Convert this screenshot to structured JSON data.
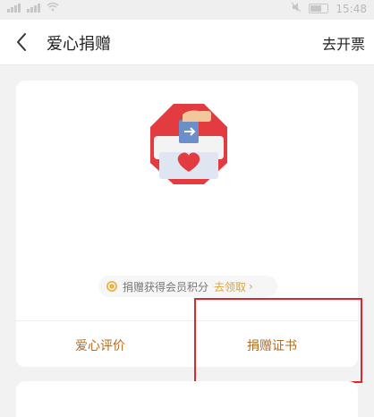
{
  "status_bar": {
    "time": "15:48"
  },
  "header": {
    "title": "爱心捐赠",
    "right_action": "去开票"
  },
  "points": {
    "text": "捐赠获得会员积分",
    "link": "去领取",
    "chevron": "›"
  },
  "actions": {
    "review": "爱心评价",
    "certificate": "捐赠证书"
  },
  "colors": {
    "accent_gold": "#d9a441",
    "action_brown": "#b06b22",
    "highlight_red": "#e0262c",
    "heart_red": "#e23b40"
  },
  "icons": [
    "back-icon",
    "donation-box-icon",
    "coin-icon",
    "chevron-right-icon"
  ]
}
